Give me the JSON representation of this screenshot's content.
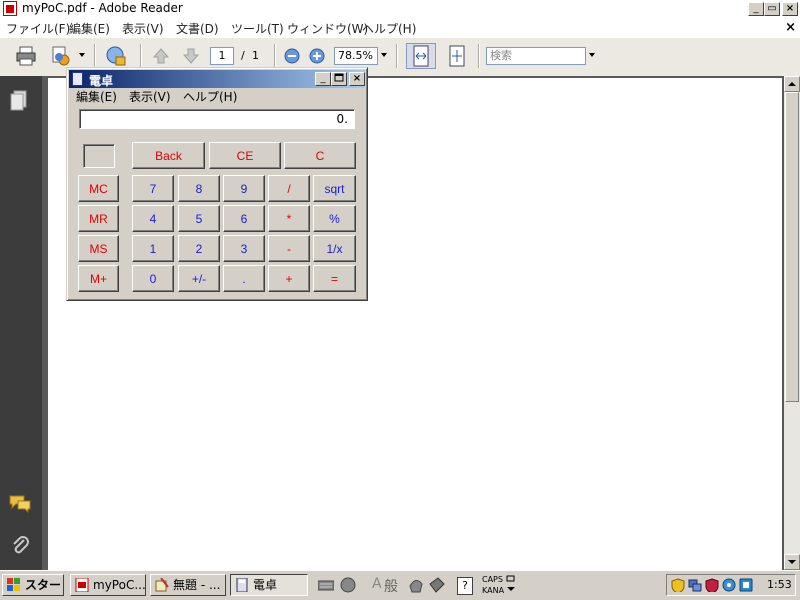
{
  "reader": {
    "title": "myPoC.pdf - Adobe Reader",
    "menu": [
      "ファイル(F)",
      "編集(E)",
      "表示(V)",
      "文書(D)",
      "ツール(T)",
      "ウィンドウ(W)",
      "ヘルプ(H)"
    ],
    "window_controls": {
      "minimize": "_",
      "restore": "▭",
      "close": "×"
    },
    "doc_close": "×",
    "toolbar": {
      "page_current": "1",
      "page_sep": "/",
      "page_total": "1",
      "zoom": "78.5%",
      "search_placeholder": "検索"
    }
  },
  "calculator": {
    "title": "電卓",
    "menu": [
      "編集(E)",
      "表示(V)",
      "ヘルプ(H)"
    ],
    "display": "0.",
    "top_keys": [
      "Back",
      "CE",
      "C"
    ],
    "memory_keys": [
      "MC",
      "MR",
      "MS",
      "M+"
    ],
    "keypad": [
      [
        "7",
        "8",
        "9",
        "/",
        "sqrt"
      ],
      [
        "4",
        "5",
        "6",
        "*",
        "%"
      ],
      [
        "1",
        "2",
        "3",
        "-",
        "1/x"
      ],
      [
        "0",
        "+/-",
        ".",
        "+",
        "="
      ]
    ]
  },
  "taskbar": {
    "start": "スタート",
    "buttons": [
      {
        "label": "myPoC..."
      },
      {
        "label": "無題 - ..."
      },
      {
        "label": "電卓"
      }
    ],
    "ime": {
      "char": "般",
      "caps": "CAPS",
      "kana": "KANA"
    },
    "clock": "1:53"
  },
  "colors": {
    "calc_red": "#e00000",
    "calc_blue": "#1c1cd8",
    "title_active": "#0a246a"
  }
}
